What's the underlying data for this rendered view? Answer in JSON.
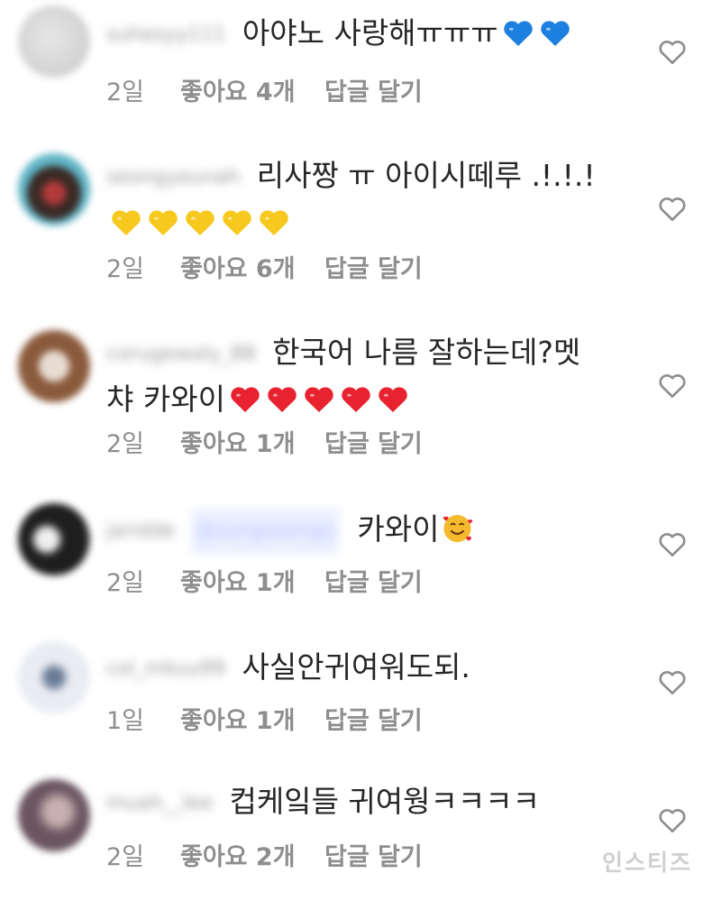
{
  "comments": [
    {
      "username": "suhesyy111",
      "text_line1": "아야노 사랑해ㅠㅠㅠ",
      "text_line2": "",
      "emoji_name": "blue-heart-icon",
      "emoji_count": 2,
      "emoji_color": "#1d7fe0",
      "time": "2일",
      "likes": "좋아요 4개",
      "reply": "답글 달기"
    },
    {
      "username": "seongyeunah",
      "text_line1": "리사짱 ㅠ 아이시떼루 .!.!.!",
      "text_line2": "",
      "emoji_name": "yellow-heart-icon",
      "emoji_count": 5,
      "emoji_color": "#f7c81e",
      "time": "2일",
      "likes": "좋아요 6개",
      "reply": "답글 달기"
    },
    {
      "username": "corugewaly_88",
      "text_line1": "한국어 나름 잘하는데?멧",
      "text_line2": "챠 카와이",
      "emoji_name": "red-heart-icon",
      "emoji_count": 5,
      "emoji_color": "#e8222e",
      "time": "2일",
      "likes": "좋아요 1개",
      "reply": "답글 달기"
    },
    {
      "username": "jaridde",
      "mention": "@sungseongo",
      "text_line1": "카와이",
      "text_line2": "",
      "emoji_name": "smiling-face-with-hearts-icon",
      "emoji_count": 1,
      "emoji_color": "#f5b92e",
      "time": "2일",
      "likes": "좋아요 1개",
      "reply": "답글 달기"
    },
    {
      "username": "col_mkuu99",
      "text_line1": "사실안귀여워도되.",
      "text_line2": "",
      "emoji_name": "",
      "emoji_count": 0,
      "time": "1일",
      "likes": "좋아요 1개",
      "reply": "답글 달기"
    },
    {
      "username": "muah__lee",
      "text_line1": "컵케잌들 귀여웡ㅋㅋㅋㅋ",
      "text_line2": "",
      "emoji_name": "",
      "emoji_count": 0,
      "time": "2일",
      "likes": "좋아요 2개",
      "reply": "답글 달기"
    }
  ],
  "watermark": "인스티즈"
}
